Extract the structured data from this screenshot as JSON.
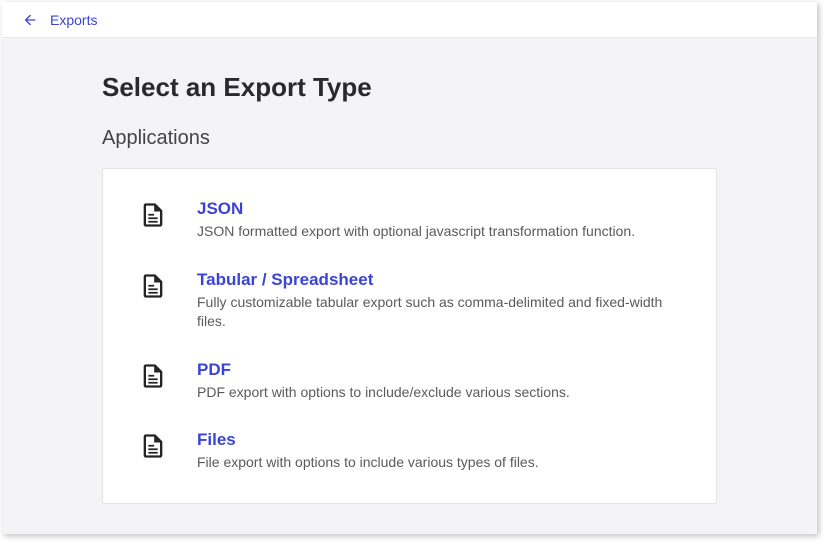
{
  "header": {
    "back_label": "Exports"
  },
  "main": {
    "title": "Select an Export Type",
    "section_heading": "Applications",
    "options": [
      {
        "title": "JSON",
        "description": "JSON formatted export with optional javascript transformation function."
      },
      {
        "title": "Tabular / Spreadsheet",
        "description": "Fully customizable tabular export such as comma-delimited and fixed-width files."
      },
      {
        "title": "PDF",
        "description": "PDF export with options to include/exclude various sections."
      },
      {
        "title": "Files",
        "description": "File export with options to include various types of files."
      }
    ]
  }
}
